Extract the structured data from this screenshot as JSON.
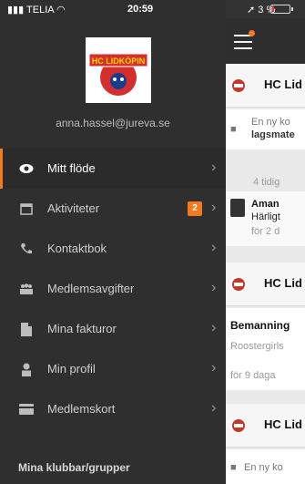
{
  "status": {
    "carrier": "TELIA",
    "time": "20:59",
    "battery_pct": "3 %"
  },
  "drawer": {
    "club_logo_text": "HC LIDKÖPIN",
    "email": "anna.hassel@jureva.se",
    "menu": [
      {
        "label": "Mitt flöde",
        "icon": "eye-icon",
        "active": true
      },
      {
        "label": "Aktiviteter",
        "icon": "calendar-icon",
        "badge": "2"
      },
      {
        "label": "Kontaktbok",
        "icon": "phone-icon"
      },
      {
        "label": "Medlemsavgifter",
        "icon": "group-icon"
      },
      {
        "label": "Mina fakturor",
        "icon": "document-icon"
      },
      {
        "label": "Min profil",
        "icon": "user-icon"
      },
      {
        "label": "Medlemskort",
        "icon": "card-icon"
      }
    ],
    "clubs_title": "Mina klubbar/grupper"
  },
  "feed": {
    "card1_title": "HC Lid",
    "card1_text1": "En ny ko",
    "card1_text2": "lagsmate",
    "card1_sub": "4 tidig",
    "card1_name": "Aman",
    "card1_msg": "Härligt",
    "card1_time": "för 2 d",
    "card2_title": "HC Lid",
    "card2_heading": "Bemanning",
    "card2_sub": "Roostergirls",
    "card2_time": "för 9 daga",
    "card3_title": "HC Lid",
    "card3_text": "En ny ko"
  },
  "colors": {
    "accent": "#f47a20",
    "drawer_bg": "#2f2f2f"
  }
}
